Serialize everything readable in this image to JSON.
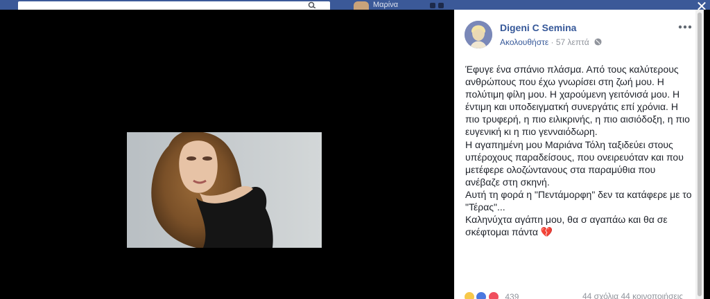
{
  "theater": {
    "close_label": "✕",
    "photo_icon": "portrait-photo"
  },
  "top_bar": {
    "search_icon": "search-icon",
    "user_name": "Μαρίνα"
  },
  "post": {
    "author": "Digeni C Semina",
    "follow_label": "Ακολουθήστε",
    "separator": " · ",
    "time": "57 λεπτά",
    "privacy_icon": "globe-icon",
    "more_icon": "more-options-icon",
    "lines": [
      "Έφυγε ένα σπάνιο πλάσμα. Από τους καλύτερους ανθρώπους που έχω γνωρίσει στη ζωή μου. Η πολύτιμη φίλη μου. Η χαρούμενη γειτόνισά μου. Η έντιμη και υποδειγματκή συνεργάτις επί χρόνια. Η πιο τρυφερή, η πιο ειλικρινής, η πιο αισιόδοξη, η πιο ευγενική κι η πιο γενναιόδωρη.",
      "Η αγαπημένη μου Μαριάνα Τόλη ταξιδεύει στους υπέροχους παραδείσους, που ονειρευόταν και που μετέφερε ολοζώντανους στα παραμύθια που ανέβαζε στη σκηνή.",
      "Αυτή τη φορά η \"Πεντάμορφη\" δεν τα κατάφερε με το \"Τέρας\"...",
      "Καληνύχτα αγάπη μου, θα σ αγαπάω και θα σε σκέφτομαι πάντα 💔"
    ],
    "reaction_count": "439",
    "comments": "44 σχόλια",
    "shares": "44 κοινοποιήσεις"
  },
  "colors": {
    "link": "#365899",
    "muted": "#90949c",
    "text": "#1d2129",
    "fb_blue": "#3b5998"
  }
}
